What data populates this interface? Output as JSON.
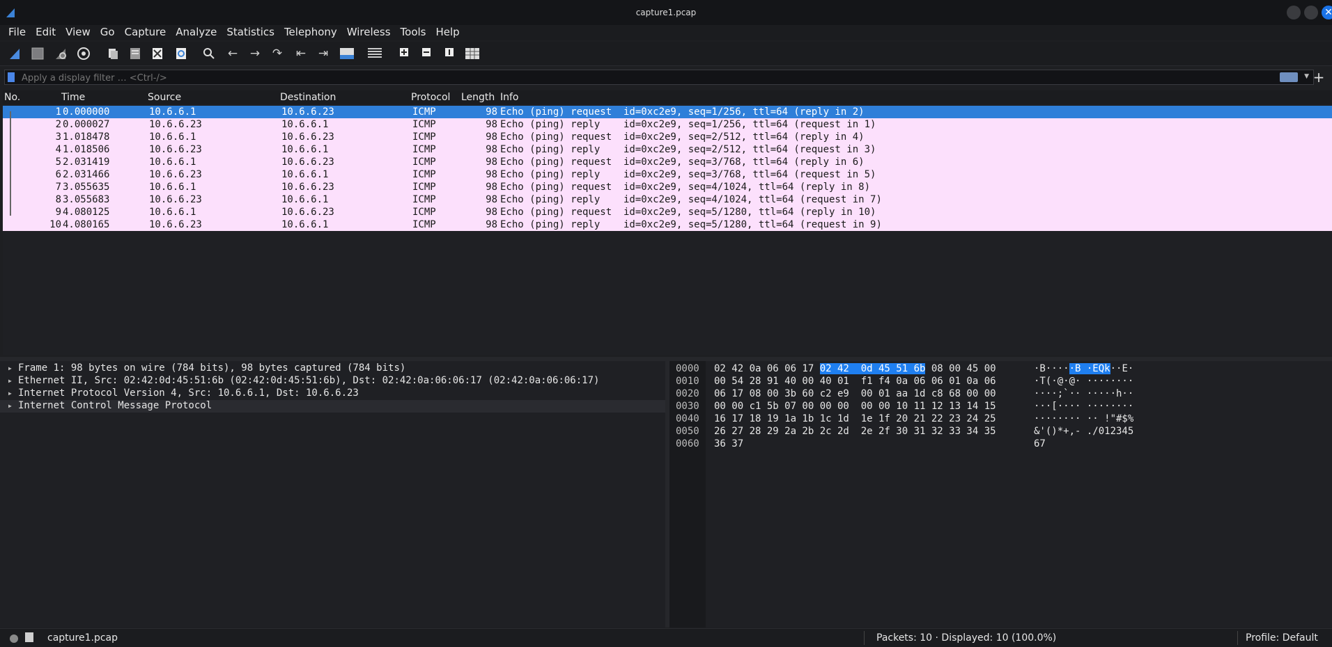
{
  "window": {
    "title": "capture1.pcap"
  },
  "menu": [
    "File",
    "Edit",
    "View",
    "Go",
    "Capture",
    "Analyze",
    "Statistics",
    "Telephony",
    "Wireless",
    "Tools",
    "Help"
  ],
  "filter": {
    "placeholder": "Apply a display filter … <Ctrl-/>",
    "value": ""
  },
  "packet_list": {
    "columns": [
      "No.",
      "Time",
      "Source",
      "Destination",
      "Protocol",
      "Length",
      "Info"
    ],
    "rows": [
      {
        "no": "1",
        "time": "0.000000",
        "src": "10.6.6.1",
        "dst": "10.6.6.23",
        "proto": "ICMP",
        "len": "98",
        "info": "Echo (ping) request  id=0xc2e9, seq=1/256, ttl=64 (reply in 2)"
      },
      {
        "no": "2",
        "time": "0.000027",
        "src": "10.6.6.23",
        "dst": "10.6.6.1",
        "proto": "ICMP",
        "len": "98",
        "info": "Echo (ping) reply    id=0xc2e9, seq=1/256, ttl=64 (request in 1)"
      },
      {
        "no": "3",
        "time": "1.018478",
        "src": "10.6.6.1",
        "dst": "10.6.6.23",
        "proto": "ICMP",
        "len": "98",
        "info": "Echo (ping) request  id=0xc2e9, seq=2/512, ttl=64 (reply in 4)"
      },
      {
        "no": "4",
        "time": "1.018506",
        "src": "10.6.6.23",
        "dst": "10.6.6.1",
        "proto": "ICMP",
        "len": "98",
        "info": "Echo (ping) reply    id=0xc2e9, seq=2/512, ttl=64 (request in 3)"
      },
      {
        "no": "5",
        "time": "2.031419",
        "src": "10.6.6.1",
        "dst": "10.6.6.23",
        "proto": "ICMP",
        "len": "98",
        "info": "Echo (ping) request  id=0xc2e9, seq=3/768, ttl=64 (reply in 6)"
      },
      {
        "no": "6",
        "time": "2.031466",
        "src": "10.6.6.23",
        "dst": "10.6.6.1",
        "proto": "ICMP",
        "len": "98",
        "info": "Echo (ping) reply    id=0xc2e9, seq=3/768, ttl=64 (request in 5)"
      },
      {
        "no": "7",
        "time": "3.055635",
        "src": "10.6.6.1",
        "dst": "10.6.6.23",
        "proto": "ICMP",
        "len": "98",
        "info": "Echo (ping) request  id=0xc2e9, seq=4/1024, ttl=64 (reply in 8)"
      },
      {
        "no": "8",
        "time": "3.055683",
        "src": "10.6.6.23",
        "dst": "10.6.6.1",
        "proto": "ICMP",
        "len": "98",
        "info": "Echo (ping) reply    id=0xc2e9, seq=4/1024, ttl=64 (request in 7)"
      },
      {
        "no": "9",
        "time": "4.080125",
        "src": "10.6.6.1",
        "dst": "10.6.6.23",
        "proto": "ICMP",
        "len": "98",
        "info": "Echo (ping) request  id=0xc2e9, seq=5/1280, ttl=64 (reply in 10)"
      },
      {
        "no": "10",
        "time": "4.080165",
        "src": "10.6.6.23",
        "dst": "10.6.6.1",
        "proto": "ICMP",
        "len": "98",
        "info": "Echo (ping) reply    id=0xc2e9, seq=5/1280, ttl=64 (request in 9)"
      }
    ]
  },
  "details": [
    "Frame 1: 98 bytes on wire (784 bits), 98 bytes captured (784 bits)",
    "Ethernet II, Src: 02:42:0d:45:51:6b (02:42:0d:45:51:6b), Dst: 02:42:0a:06:06:17 (02:42:0a:06:06:17)",
    "Internet Protocol Version 4, Src: 10.6.6.1, Dst: 10.6.6.23",
    "Internet Control Message Protocol"
  ],
  "bytes": [
    {
      "off": "0000",
      "hex_pre": "02 42 0a 06 06 17 ",
      "hex_hl": "02 42  0d 45 51 6b",
      "hex_post": " 08 00 45 00",
      "asc_pre": "·B····",
      "asc_hl": "·B ·EQk",
      "asc_post": "··E·"
    },
    {
      "off": "0010",
      "hex_pre": "00 54 28 91 40 00 40 01  f1 f4 0a 06 06 01 0a 06",
      "hex_hl": "",
      "hex_post": "",
      "asc_pre": "·T(·@·@· ········",
      "asc_hl": "",
      "asc_post": ""
    },
    {
      "off": "0020",
      "hex_pre": "06 17 08 00 3b 60 c2 e9  00 01 aa 1d c8 68 00 00",
      "hex_hl": "",
      "hex_post": "",
      "asc_pre": "····;`·· ·····h··",
      "asc_hl": "",
      "asc_post": ""
    },
    {
      "off": "0030",
      "hex_pre": "00 00 c1 5b 07 00 00 00  00 00 10 11 12 13 14 15",
      "hex_hl": "",
      "hex_post": "",
      "asc_pre": "···[···· ········",
      "asc_hl": "",
      "asc_post": ""
    },
    {
      "off": "0040",
      "hex_pre": "16 17 18 19 1a 1b 1c 1d  1e 1f 20 21 22 23 24 25",
      "hex_hl": "",
      "hex_post": "",
      "asc_pre": "········ ·· !\"#$%",
      "asc_hl": "",
      "asc_post": ""
    },
    {
      "off": "0050",
      "hex_pre": "26 27 28 29 2a 2b 2c 2d  2e 2f 30 31 32 33 34 35",
      "hex_hl": "",
      "hex_post": "",
      "asc_pre": "&'()*+,- ./012345",
      "asc_hl": "",
      "asc_post": ""
    },
    {
      "off": "0060",
      "hex_pre": "36 37",
      "hex_hl": "",
      "hex_post": "",
      "asc_pre": "67",
      "asc_hl": "",
      "asc_post": ""
    }
  ],
  "status": {
    "file": "capture1.pcap",
    "packets": "Packets: 10 · Displayed: 10 (100.0%)",
    "profile": "Profile: Default"
  },
  "colors": {
    "selected": "#2f7fd9",
    "icmp_row": "#fce0fc",
    "hex_highlight": "#1f7ff0"
  },
  "toolbar_icons": [
    "shark-fin-start-icon",
    "stop-capture-icon",
    "restart-capture-icon",
    "capture-options-icon",
    "open-file-icon",
    "save-file-icon",
    "close-file-icon",
    "reload-file-icon",
    "find-packet-icon",
    "go-back-icon",
    "go-forward-icon",
    "go-to-packet-icon",
    "first-packet-icon",
    "last-packet-icon",
    "auto-scroll-icon",
    "colorize-icon",
    "zoom-in-icon",
    "zoom-out-icon",
    "normal-size-icon",
    "resize-columns-icon"
  ]
}
